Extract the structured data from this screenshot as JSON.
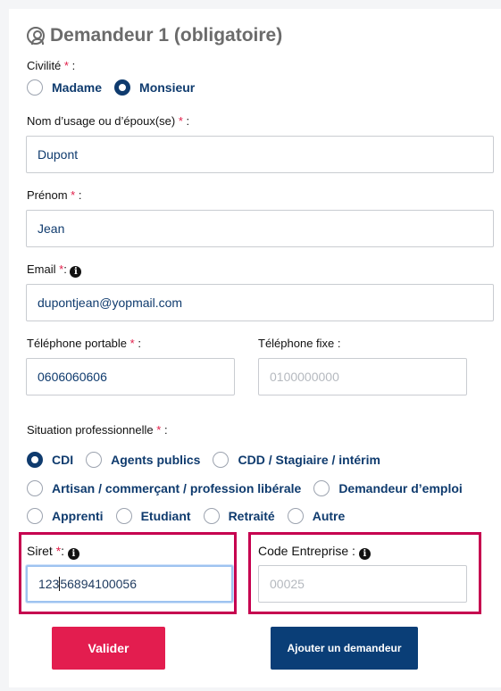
{
  "section": {
    "title": "Demandeur 1 (obligatoire)"
  },
  "civilite": {
    "label": "Civilité",
    "options": [
      {
        "label": "Madame",
        "checked": false
      },
      {
        "label": "Monsieur",
        "checked": true
      }
    ]
  },
  "nom": {
    "label": "Nom d’usage ou d’époux(se)",
    "value": "Dupont"
  },
  "prenom": {
    "label": "Prénom",
    "value": "Jean"
  },
  "email": {
    "label": "Email",
    "value": "dupontjean@yopmail.com"
  },
  "tel_portable": {
    "label": "Téléphone portable",
    "value": "0606060606"
  },
  "tel_fixe": {
    "label": "Téléphone fixe :",
    "placeholder": "0100000000"
  },
  "situation": {
    "label": "Situation professionnelle",
    "options": [
      "CDI",
      "Agents publics",
      "CDD / Stagiaire / intérim",
      "Artisan / commerçant / profession libérale",
      "Demandeur d’emploi",
      "Apprenti",
      "Etudiant",
      "Retraité",
      "Autre"
    ],
    "selected": "CDI"
  },
  "siret": {
    "label": "Siret",
    "value_before_caret": "123",
    "value_after_caret": "56894100056"
  },
  "code_entreprise": {
    "label": "Code Entreprise :",
    "placeholder": "00025"
  },
  "buttons": {
    "valider": "Valider",
    "ajouter": "Ajouter un demandeur"
  },
  "colors": {
    "required": "#e11d48",
    "navy": "#0f3b6e",
    "highlight": "#c6004f",
    "submit": "#e31d4f"
  },
  "common": {
    "req_star": "*",
    "colon": " :",
    "info_glyph": "i"
  }
}
